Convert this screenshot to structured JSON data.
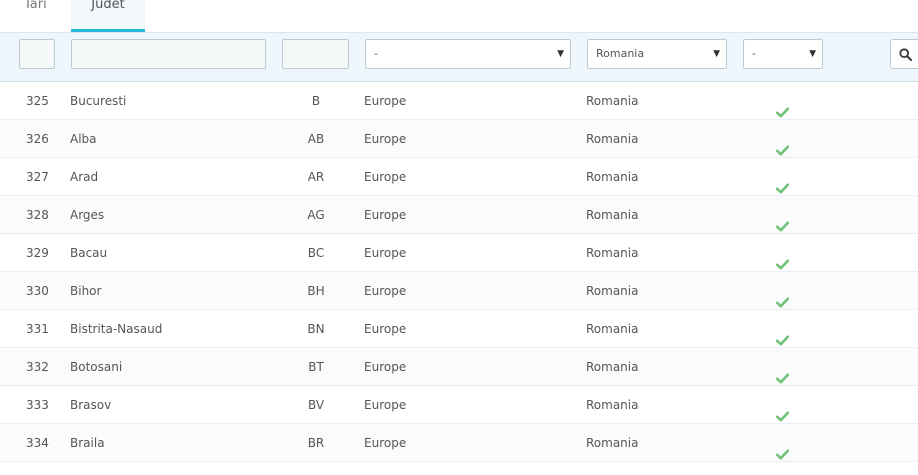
{
  "tabs": [
    {
      "label": "Tari"
    },
    {
      "label": "Judet"
    }
  ],
  "filters": {
    "zone_value": "-",
    "country_value": "Romania",
    "active_value": "-"
  },
  "colors": {
    "accent": "#25b9d7",
    "check": "#72c279"
  },
  "rows": [
    {
      "id": "325",
      "name": "Bucuresti",
      "iso": "B",
      "zone": "Europe",
      "country": "Romania",
      "status_icon": "check-icon"
    },
    {
      "id": "326",
      "name": "Alba",
      "iso": "AB",
      "zone": "Europe",
      "country": "Romania",
      "status_icon": "check-icon"
    },
    {
      "id": "327",
      "name": "Arad",
      "iso": "AR",
      "zone": "Europe",
      "country": "Romania",
      "status_icon": "check-icon"
    },
    {
      "id": "328",
      "name": "Arges",
      "iso": "AG",
      "zone": "Europe",
      "country": "Romania",
      "status_icon": "check-icon"
    },
    {
      "id": "329",
      "name": "Bacau",
      "iso": "BC",
      "zone": "Europe",
      "country": "Romania",
      "status_icon": "check-icon"
    },
    {
      "id": "330",
      "name": "Bihor",
      "iso": "BH",
      "zone": "Europe",
      "country": "Romania",
      "status_icon": "check-icon"
    },
    {
      "id": "331",
      "name": "Bistrita-Nasaud",
      "iso": "BN",
      "zone": "Europe",
      "country": "Romania",
      "status_icon": "check-icon"
    },
    {
      "id": "332",
      "name": "Botosani",
      "iso": "BT",
      "zone": "Europe",
      "country": "Romania",
      "status_icon": "check-icon"
    },
    {
      "id": "333",
      "name": "Brasov",
      "iso": "BV",
      "zone": "Europe",
      "country": "Romania",
      "status_icon": "check-icon"
    },
    {
      "id": "334",
      "name": "Braila",
      "iso": "BR",
      "zone": "Europe",
      "country": "Romania",
      "status_icon": "check-icon"
    }
  ]
}
